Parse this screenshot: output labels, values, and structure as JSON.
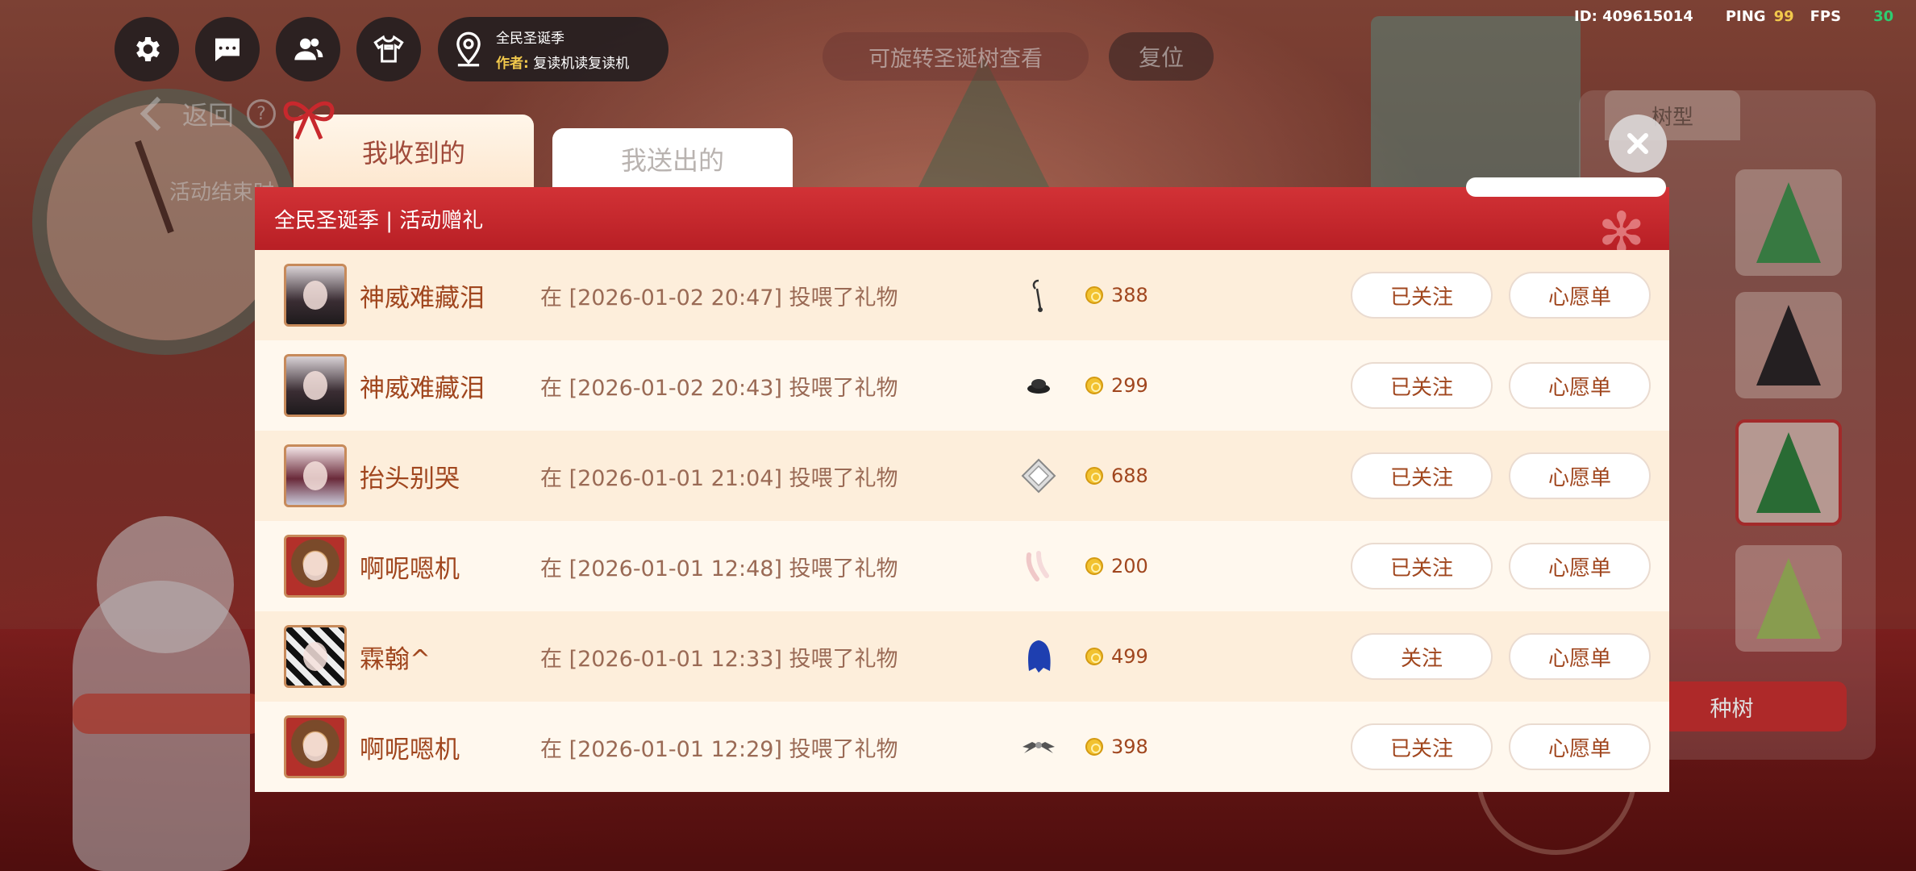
{
  "status": {
    "id": "ID: 409615014",
    "ping_label": "PING",
    "ping": "99",
    "fps_label": "FPS",
    "fps": "30"
  },
  "hud": {
    "season_title": "全民圣诞季",
    "author_key": "作者:",
    "author_name": "复读机读复读机",
    "back": "返回",
    "help": "?",
    "end_time": "活动结束时"
  },
  "top": {
    "rotate_hint": "可旋转圣诞树查看",
    "reset": "复位"
  },
  "tree_panel": {
    "tab": "树型",
    "plant": "种树"
  },
  "tabs": {
    "received": "我收到的",
    "sent": "我送出的"
  },
  "modal": {
    "title": "全民圣诞季 | 活动赠礼"
  },
  "rows": [
    {
      "name": "神威难藏泪",
      "text": "在 [2026-01-02 20:47] 投喂了礼物",
      "price": "388",
      "follow": "已关注",
      "wish": "心愿单",
      "avatar": "girl",
      "gift": "earring-icon"
    },
    {
      "name": "神威难藏泪",
      "text": "在 [2026-01-02 20:43] 投喂了礼物",
      "price": "299",
      "follow": "已关注",
      "wish": "心愿单",
      "avatar": "girl",
      "gift": "hat-icon"
    },
    {
      "name": "抬头别哭",
      "text": "在 [2026-01-01 21:04] 投喂了礼物",
      "price": "688",
      "follow": "已关注",
      "wish": "心愿单",
      "avatar": "girl2",
      "gift": "crystal-icon"
    },
    {
      "name": "啊呢嗯机",
      "text": "在 [2026-01-01 12:48] 投喂了礼物",
      "price": "200",
      "follow": "已关注",
      "wish": "心愿单",
      "avatar": "beast",
      "gift": "gloves-icon"
    },
    {
      "name": "霖翰^",
      "text": "在 [2026-01-01 12:33] 投喂了礼物",
      "price": "499",
      "follow": "关注",
      "wish": "心愿单",
      "avatar": "ink",
      "gift": "blue-hair-icon"
    },
    {
      "name": "啊呢嗯机",
      "text": "在 [2026-01-01 12:29] 投喂了礼物",
      "price": "398",
      "follow": "已关注",
      "wish": "心愿单",
      "avatar": "beast",
      "gift": "wings-icon"
    }
  ],
  "colors": {
    "header": "#c8282d",
    "accent": "#a0461e",
    "coin": "#f2c230"
  }
}
